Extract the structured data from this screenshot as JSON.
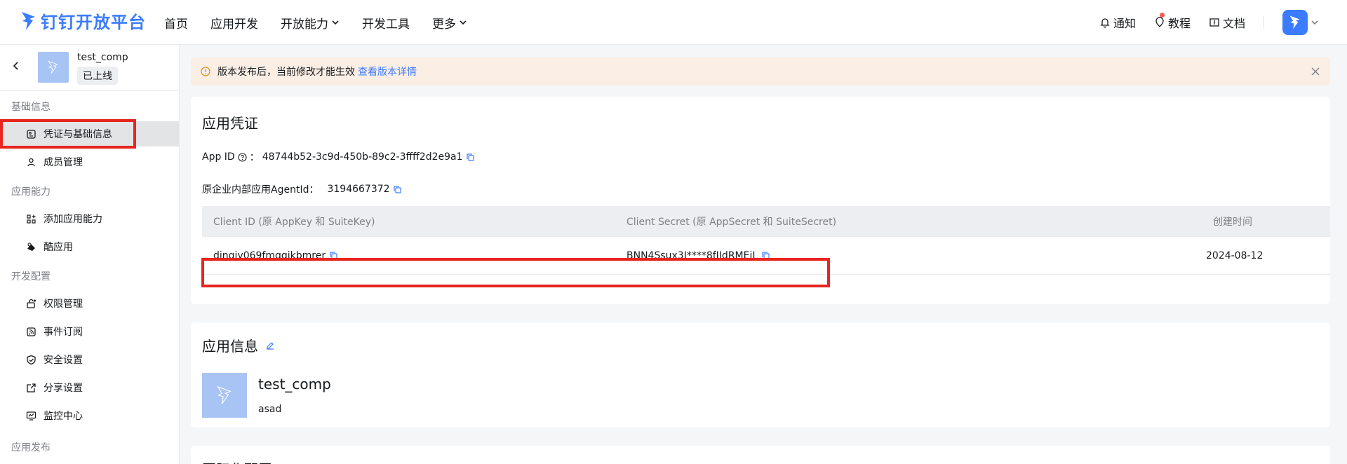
{
  "header": {
    "logo_text": "钉钉开放平台",
    "nav": [
      "首页",
      "应用开发",
      "开放能力",
      "开发工具",
      "更多"
    ],
    "right": {
      "notify": "通知",
      "tutorial": "教程",
      "docs": "文档"
    },
    "brand_color": "#3b7cff"
  },
  "sidebar": {
    "app_name": "test_comp",
    "app_status": "已上线",
    "sections": [
      {
        "title": "基础信息",
        "items": [
          "凭证与基础信息",
          "成员管理"
        ]
      },
      {
        "title": "应用能力",
        "items": [
          "添加应用能力",
          "酷应用"
        ]
      },
      {
        "title": "开发配置",
        "items": [
          "权限管理",
          "事件订阅",
          "安全设置",
          "分享设置",
          "监控中心"
        ]
      },
      {
        "title": "应用发布",
        "items": []
      }
    ],
    "active_item": "凭证与基础信息"
  },
  "banner": {
    "text": "版本发布后，当前修改才能生效",
    "link": "查看版本详情"
  },
  "credentials": {
    "title": "应用凭证",
    "app_id_label": "App ID",
    "app_id_sep": "：",
    "app_id_value": "48744b52-3c9d-450b-89c2-3ffff2d2e9a1",
    "agent_id_label": "原企业内部应用AgentId：",
    "agent_id_value": "3194667372",
    "table": {
      "headers": [
        "Client ID (原 AppKey 和 SuiteKey)",
        "Client Secret (原 AppSecret 和 SuiteSecret)",
        "创建时间"
      ],
      "rows": [
        {
          "client_id": "dingiy069fmqgikbmrer",
          "client_secret": "BNN4Ssux3I****8fIJdRMEjL",
          "created": "2024-08-12"
        }
      ]
    }
  },
  "app_info": {
    "title": "应用信息",
    "name": "test_comp",
    "desc": "asad"
  },
  "next_card": {
    "title": "国际化配置"
  },
  "colors": {
    "highlight": "#e8251f",
    "banner_bg": "#fbeee5",
    "warning": "#f08a24"
  }
}
